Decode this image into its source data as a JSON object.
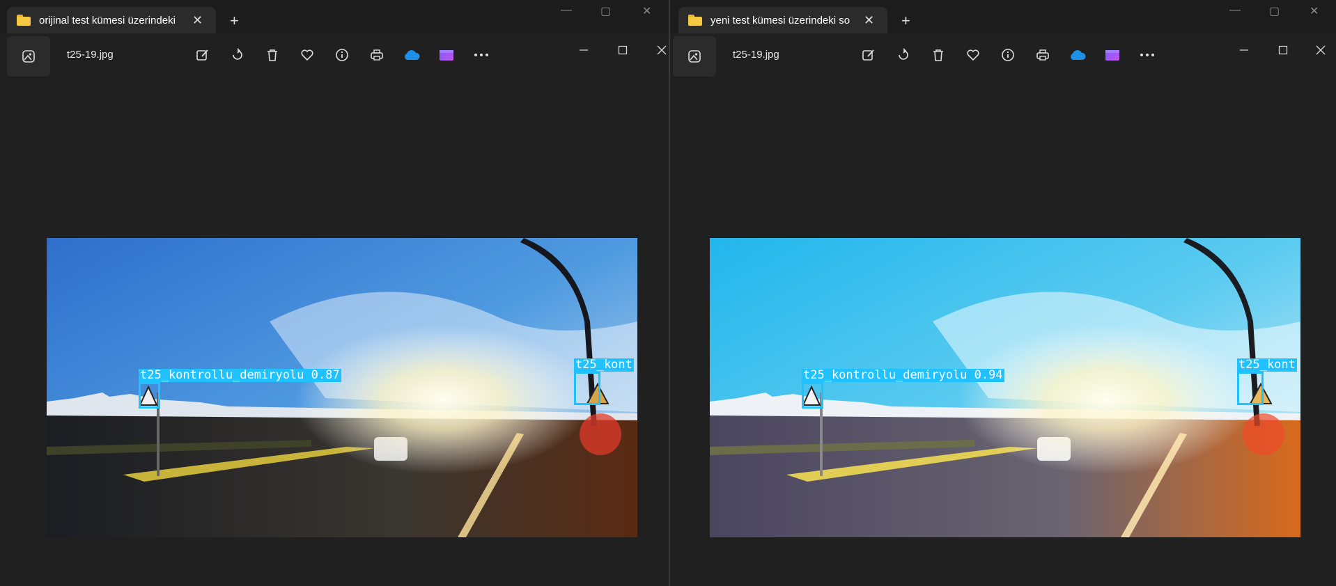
{
  "windows": [
    {
      "explorer_tab_title": "orijinal test kümesi üzerindeki",
      "new_tab": "+",
      "filename": "t25-19.jpg",
      "detections": [
        {
          "label": "t25_kontrollu_demiryolu 0.87"
        },
        {
          "label": "t25_kont"
        }
      ],
      "sky": [
        "#2f6fcc",
        "#4f9ae0",
        "#cfe3f2"
      ]
    },
    {
      "explorer_tab_title": "yeni test kümesi üzerindeki so",
      "new_tab": "+",
      "filename": "t25-19.jpg",
      "detections": [
        {
          "label": "t25_kontrollu_demiryolu 0.94"
        },
        {
          "label": "t25_kont"
        }
      ],
      "sky": [
        "#22b6ec",
        "#5ccbf0",
        "#e2f3fa"
      ]
    }
  ],
  "icons": [
    "folder-icon",
    "photos-app-icon",
    "edit-image-icon",
    "rotate-icon",
    "delete-icon",
    "favorite-icon",
    "info-icon",
    "print-icon",
    "onedrive-icon",
    "clipchamp-icon",
    "more-icon",
    "minimize-icon",
    "maximize-icon",
    "close-icon"
  ],
  "colors": {
    "detection": "#1fc1ff",
    "background": "#202020"
  }
}
